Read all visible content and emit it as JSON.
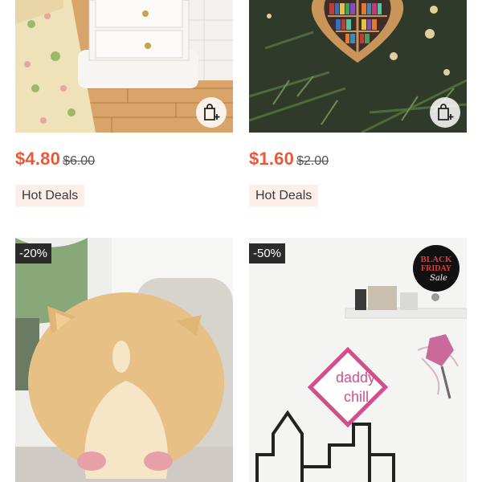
{
  "products": [
    {
      "price": "$4.80",
      "original_price": "$6.00",
      "tag": "Hot Deals"
    },
    {
      "price": "$1.60",
      "original_price": "$2.00",
      "tag": "Hot Deals"
    },
    {
      "discount": "-20%"
    },
    {
      "discount": "-50%",
      "badge": {
        "line1": "BLACK",
        "line2": "FRIDAY",
        "line3": "Sale"
      },
      "sign": {
        "line1": "daddy",
        "line2": "chill"
      }
    }
  ],
  "colors": {
    "price": "#e8593a",
    "tag_bg": "#fdeee9",
    "discount_bg": "#2b2b2b"
  },
  "icons": {
    "add_to_cart": "shopping-bag-plus-icon"
  }
}
